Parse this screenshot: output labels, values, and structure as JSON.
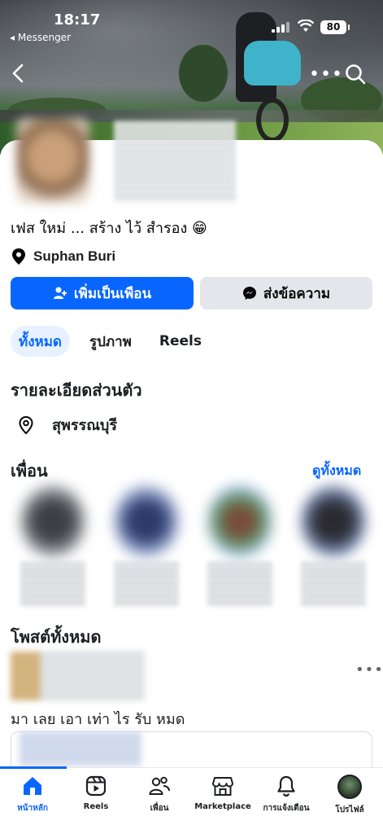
{
  "status_bar": {
    "time": "18:17",
    "back_app": "◂ Messenger",
    "battery": "80"
  },
  "profile": {
    "bio": "เฟส ใหม่ ... สร้าง ไว้ สำรอง 😁",
    "location": "Suphan Buri",
    "add_friend_label": "เพิ่มเป็นเพือน",
    "message_label": "ส่งข้อความ"
  },
  "tabs": [
    "ทั้งหมด",
    "รูปภาพ",
    "Reels"
  ],
  "details": {
    "title": "รายละเอียดส่วนตัว",
    "place": "สุพรรณบุรี"
  },
  "friends": {
    "title": "เพื่อน",
    "see_all": "ดูทั้งหมด"
  },
  "posts": {
    "title": "โพสต์ทั้งหมด",
    "text": "มา เลย เอา เท่า ไร รับ หมด"
  },
  "bottom_nav": [
    {
      "label": "หน้าหลัก",
      "icon": "home-icon"
    },
    {
      "label": "Reels",
      "icon": "reels-icon"
    },
    {
      "label": "เพื่อน",
      "icon": "friends-icon"
    },
    {
      "label": "Marketplace",
      "icon": "marketplace-icon"
    },
    {
      "label": "การแจ้งเตือน",
      "icon": "bell-icon"
    },
    {
      "label": "โปรไฟล์",
      "icon": "profile-avatar"
    }
  ],
  "colors": {
    "accent": "#0866ff",
    "secondary_button": "#e4e6eb",
    "active_tab_bg": "#e7f1ff"
  }
}
